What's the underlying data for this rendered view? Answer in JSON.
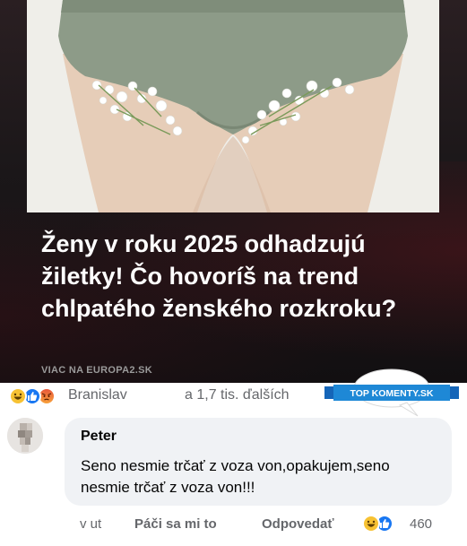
{
  "promo": {
    "headline": "Ženy v roku 2025 odhadzujú žiletky! Čo hovoríš na trend chlpatého ženského rozkroku?",
    "more_link": "VIAC NA EUROPA2.SK",
    "photo": "photo of underwear with flowers"
  },
  "reaction_bar": {
    "icons": [
      "haha-icon",
      "like-icon",
      "angry-icon"
    ],
    "first_name": "Branislav",
    "others_text": "a 1,7 tis. ďalších",
    "badge_text": "TOP KOMENTY.SK"
  },
  "comment": {
    "author": "Peter",
    "text": "Seno nesmie trčať z voza von,opakujem,seno nesmie trčať z voza von!!!",
    "time": "v ut",
    "like_label": "Páči sa mi to",
    "reply_label": "Odpovedať",
    "reaction_icons": [
      "haha-icon",
      "like-icon"
    ],
    "reaction_count": "460"
  },
  "colors": {
    "like_blue": "#1877f2",
    "haha_yellow": "#f7c233",
    "badge_blue": "#1e88d6",
    "bubble_bg": "#f0f2f5",
    "muted_text": "#65676b"
  }
}
